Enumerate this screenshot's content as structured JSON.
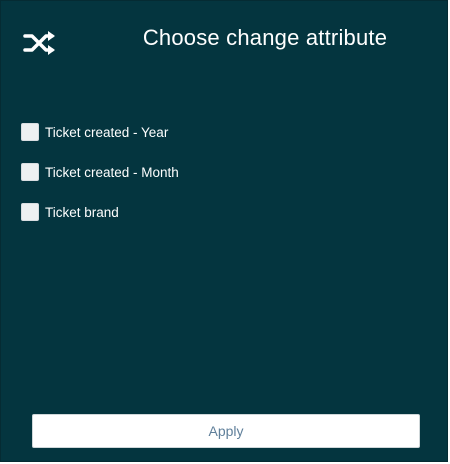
{
  "header": {
    "title": "Choose change attribute",
    "icon": "shuffle-icon"
  },
  "options": [
    {
      "label": "Ticket created - Year",
      "checked": false
    },
    {
      "label": "Ticket created - Month",
      "checked": false
    },
    {
      "label": "Ticket brand",
      "checked": false
    }
  ],
  "apply_button": {
    "label": "Apply"
  },
  "colors": {
    "panel_background": "#04353f",
    "text": "#ffffff",
    "button_text": "#5f7f9a",
    "checkbox_fill": "#eef0f1"
  }
}
